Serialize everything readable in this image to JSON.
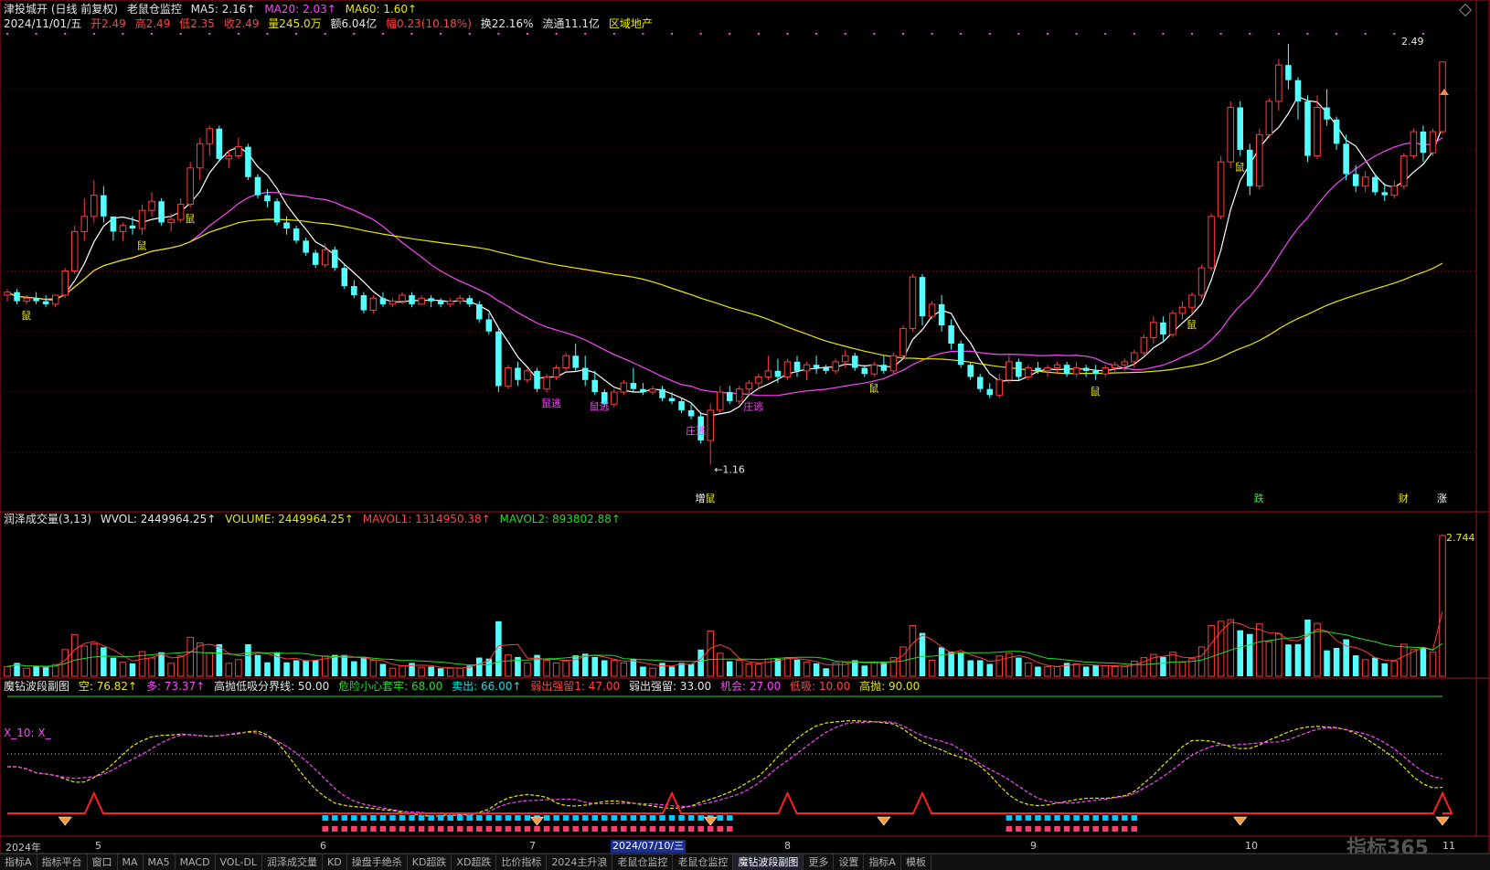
{
  "header": {
    "stock_title": "津投城开 (日线 前复权)",
    "indicator_name": "老鼠仓监控",
    "ma5": "MA5: 2.16↑",
    "ma20": "MA20: 2.03↑",
    "ma60": "MA60: 1.60↑",
    "date": "2024/11/01/五",
    "open": "开2.49",
    "high": "高2.49",
    "low": "低2.35",
    "close": "收2.49",
    "volume": "量245.0万",
    "amount": "额6.04亿",
    "change": "幅0.23(10.18%)",
    "turnover": "换22.16%",
    "float": "流通11.1亿",
    "sector": "区域地产"
  },
  "volume_panel": {
    "title": "润泽成交量(3,13)",
    "wvol": "WVOL: 2449964.25↑",
    "volume": "VOLUME: 2449964.25↑",
    "mavol1": "MAVOL1: 1314950.38↑",
    "mavol2": "MAVOL2: 893802.88↑",
    "max_label": "2.744"
  },
  "indicator_panel": {
    "title": "魔钻波段副图",
    "kong": "空: 76.82↑",
    "duo": "多: 73.37↑",
    "boundary": "高抛低吸分界线: 50.00",
    "danger": "危险小心套牢: 68.00",
    "sell": "卖出: 66.00↑",
    "weak1": "弱出强留1: 47.00",
    "weak2": "弱出强留: 33.00",
    "chance": "机会: 27.00",
    "low_buy": "低吸: 10.00",
    "high_sell": "高抛: 90.00",
    "x10": "X_10: X_"
  },
  "x_axis": {
    "labels": [
      "2024年",
      "5",
      "6",
      "7",
      "8",
      "9",
      "10",
      "11"
    ],
    "current_date": "2024/07/10/三"
  },
  "price_labels": {
    "high_marker": "2.49",
    "low_marker": "←1.16"
  },
  "signals": [
    "鼠",
    "鼠",
    "鼠",
    "鼠逃",
    "鼠逃",
    "庄逃",
    "庄逃",
    "鼠",
    "鼠",
    "鼠",
    "鼠",
    "增",
    "鼠",
    "跌",
    "财",
    "涨"
  ],
  "tabs": [
    "指标A",
    "指标平台",
    "窗口",
    "MA",
    "MA5",
    "MACD",
    "VOL-DL",
    "润泽成交量",
    "KD",
    "操盘手绝杀",
    "KD超跌",
    "XD超跌",
    "比价指标",
    "2024主升浪",
    "老鼠仓监控",
    "老鼠仓监控",
    "魔钻波段副图",
    "更多",
    "设置",
    "指标A",
    "模板"
  ],
  "logo": "指标365",
  "chart_data": {
    "type": "candlestick",
    "title": "津投城开 (日线 前复权)",
    "ylim": [
      1.05,
      2.58
    ],
    "last_close": 2.49,
    "high": 2.49,
    "low": 1.16,
    "ohlc": [
      [
        1.72,
        1.74,
        1.7,
        1.73
      ],
      [
        1.73,
        1.74,
        1.69,
        1.7
      ],
      [
        1.7,
        1.72,
        1.69,
        1.71
      ],
      [
        1.71,
        1.73,
        1.69,
        1.7
      ],
      [
        1.7,
        1.72,
        1.68,
        1.69
      ],
      [
        1.69,
        1.72,
        1.68,
        1.72
      ],
      [
        1.72,
        1.81,
        1.71,
        1.8
      ],
      [
        1.8,
        1.95,
        1.79,
        1.93
      ],
      [
        1.93,
        2.04,
        1.9,
        1.98
      ],
      [
        1.98,
        2.1,
        1.96,
        2.05
      ],
      [
        2.05,
        2.08,
        1.96,
        1.98
      ],
      [
        1.98,
        1.97,
        1.9,
        1.93
      ],
      [
        1.93,
        1.96,
        1.9,
        1.95
      ],
      [
        1.95,
        1.98,
        1.92,
        1.94
      ],
      [
        1.94,
        2.02,
        1.92,
        2.0
      ],
      [
        2.0,
        2.06,
        1.98,
        2.03
      ],
      [
        2.03,
        2.04,
        1.95,
        1.96
      ],
      [
        1.96,
        1.99,
        1.93,
        1.97
      ],
      [
        1.97,
        2.04,
        1.96,
        2.02
      ],
      [
        2.02,
        2.16,
        2.01,
        2.14
      ],
      [
        2.14,
        2.24,
        2.1,
        2.22
      ],
      [
        2.22,
        2.28,
        2.18,
        2.27
      ],
      [
        2.27,
        2.28,
        2.16,
        2.17
      ],
      [
        2.17,
        2.2,
        2.14,
        2.18
      ],
      [
        2.18,
        2.24,
        2.17,
        2.21
      ],
      [
        2.21,
        2.22,
        2.1,
        2.11
      ],
      [
        2.11,
        2.12,
        2.04,
        2.05
      ],
      [
        2.05,
        2.07,
        2.01,
        2.03
      ],
      [
        2.03,
        2.04,
        1.95,
        1.96
      ],
      [
        1.96,
        1.98,
        1.92,
        1.94
      ],
      [
        1.94,
        1.95,
        1.89,
        1.9
      ],
      [
        1.9,
        1.91,
        1.85,
        1.86
      ],
      [
        1.86,
        1.87,
        1.81,
        1.82
      ],
      [
        1.82,
        1.89,
        1.81,
        1.87
      ],
      [
        1.87,
        1.88,
        1.8,
        1.81
      ],
      [
        1.81,
        1.82,
        1.74,
        1.75
      ],
      [
        1.75,
        1.77,
        1.71,
        1.72
      ],
      [
        1.72,
        1.73,
        1.66,
        1.67
      ],
      [
        1.67,
        1.72,
        1.66,
        1.71
      ],
      [
        1.71,
        1.73,
        1.68,
        1.69
      ],
      [
        1.69,
        1.71,
        1.68,
        1.7
      ],
      [
        1.7,
        1.73,
        1.69,
        1.72
      ],
      [
        1.72,
        1.73,
        1.68,
        1.69
      ],
      [
        1.69,
        1.72,
        1.69,
        1.71
      ],
      [
        1.71,
        1.72,
        1.68,
        1.7
      ],
      [
        1.7,
        1.71,
        1.68,
        1.69
      ],
      [
        1.69,
        1.71,
        1.68,
        1.7
      ],
      [
        1.7,
        1.72,
        1.69,
        1.71
      ],
      [
        1.71,
        1.72,
        1.68,
        1.69
      ],
      [
        1.69,
        1.7,
        1.63,
        1.64
      ],
      [
        1.64,
        1.66,
        1.59,
        1.6
      ],
      [
        1.6,
        1.61,
        1.4,
        1.42
      ],
      [
        1.42,
        1.49,
        1.41,
        1.48
      ],
      [
        1.48,
        1.5,
        1.42,
        1.44
      ],
      [
        1.44,
        1.48,
        1.43,
        1.47
      ],
      [
        1.47,
        1.48,
        1.4,
        1.41
      ],
      [
        1.41,
        1.46,
        1.4,
        1.45
      ],
      [
        1.45,
        1.49,
        1.44,
        1.48
      ],
      [
        1.48,
        1.53,
        1.47,
        1.52
      ],
      [
        1.52,
        1.56,
        1.47,
        1.48
      ],
      [
        1.48,
        1.52,
        1.42,
        1.44
      ],
      [
        1.44,
        1.47,
        1.39,
        1.4
      ],
      [
        1.4,
        1.41,
        1.35,
        1.36
      ],
      [
        1.36,
        1.41,
        1.35,
        1.4
      ],
      [
        1.4,
        1.44,
        1.39,
        1.43
      ],
      [
        1.43,
        1.48,
        1.4,
        1.41
      ],
      [
        1.41,
        1.43,
        1.39,
        1.4
      ],
      [
        1.4,
        1.42,
        1.39,
        1.41
      ],
      [
        1.41,
        1.42,
        1.37,
        1.38
      ],
      [
        1.38,
        1.4,
        1.36,
        1.37
      ],
      [
        1.37,
        1.38,
        1.33,
        1.34
      ],
      [
        1.34,
        1.36,
        1.31,
        1.32
      ],
      [
        1.32,
        1.33,
        1.23,
        1.24
      ],
      [
        1.24,
        1.36,
        1.16,
        1.34
      ],
      [
        1.34,
        1.42,
        1.33,
        1.4
      ],
      [
        1.4,
        1.42,
        1.36,
        1.37
      ],
      [
        1.37,
        1.42,
        1.36,
        1.41
      ],
      [
        1.41,
        1.44,
        1.39,
        1.43
      ],
      [
        1.43,
        1.46,
        1.41,
        1.45
      ],
      [
        1.45,
        1.52,
        1.44,
        1.47
      ],
      [
        1.47,
        1.51,
        1.43,
        1.45
      ],
      [
        1.45,
        1.51,
        1.44,
        1.5
      ],
      [
        1.5,
        1.52,
        1.45,
        1.47
      ],
      [
        1.47,
        1.5,
        1.44,
        1.49
      ],
      [
        1.49,
        1.52,
        1.46,
        1.48
      ],
      [
        1.48,
        1.49,
        1.46,
        1.47
      ],
      [
        1.47,
        1.51,
        1.46,
        1.5
      ],
      [
        1.5,
        1.54,
        1.48,
        1.52
      ],
      [
        1.52,
        1.53,
        1.47,
        1.48
      ],
      [
        1.48,
        1.49,
        1.45,
        1.46
      ],
      [
        1.46,
        1.5,
        1.45,
        1.49
      ],
      [
        1.49,
        1.52,
        1.46,
        1.47
      ],
      [
        1.47,
        1.53,
        1.46,
        1.52
      ],
      [
        1.52,
        1.62,
        1.51,
        1.61
      ],
      [
        1.61,
        1.79,
        1.6,
        1.78
      ],
      [
        1.78,
        1.79,
        1.62,
        1.65
      ],
      [
        1.65,
        1.7,
        1.64,
        1.69
      ],
      [
        1.69,
        1.72,
        1.6,
        1.62
      ],
      [
        1.62,
        1.64,
        1.54,
        1.56
      ],
      [
        1.56,
        1.57,
        1.48,
        1.49
      ],
      [
        1.49,
        1.5,
        1.44,
        1.45
      ],
      [
        1.45,
        1.46,
        1.4,
        1.41
      ],
      [
        1.41,
        1.43,
        1.38,
        1.39
      ],
      [
        1.39,
        1.46,
        1.38,
        1.44
      ],
      [
        1.44,
        1.52,
        1.43,
        1.5
      ],
      [
        1.5,
        1.51,
        1.44,
        1.45
      ],
      [
        1.45,
        1.49,
        1.44,
        1.48
      ],
      [
        1.48,
        1.5,
        1.46,
        1.47
      ],
      [
        1.47,
        1.49,
        1.45,
        1.48
      ],
      [
        1.48,
        1.5,
        1.46,
        1.49
      ],
      [
        1.49,
        1.5,
        1.45,
        1.46
      ],
      [
        1.46,
        1.5,
        1.45,
        1.48
      ],
      [
        1.48,
        1.49,
        1.45,
        1.47
      ],
      [
        1.47,
        1.49,
        1.44,
        1.46
      ],
      [
        1.46,
        1.49,
        1.45,
        1.48
      ],
      [
        1.48,
        1.5,
        1.46,
        1.49
      ],
      [
        1.49,
        1.51,
        1.47,
        1.5
      ],
      [
        1.5,
        1.54,
        1.48,
        1.53
      ],
      [
        1.53,
        1.59,
        1.52,
        1.58
      ],
      [
        1.58,
        1.65,
        1.56,
        1.63
      ],
      [
        1.63,
        1.65,
        1.57,
        1.59
      ],
      [
        1.59,
        1.67,
        1.58,
        1.66
      ],
      [
        1.66,
        1.7,
        1.64,
        1.68
      ],
      [
        1.68,
        1.73,
        1.66,
        1.72
      ],
      [
        1.72,
        1.82,
        1.71,
        1.81
      ],
      [
        1.81,
        1.99,
        1.8,
        1.98
      ],
      [
        1.98,
        2.18,
        1.97,
        2.16
      ],
      [
        2.16,
        2.36,
        2.14,
        2.34
      ],
      [
        2.34,
        2.36,
        2.18,
        2.2
      ],
      [
        2.2,
        2.22,
        2.05,
        2.08
      ],
      [
        2.08,
        2.27,
        2.07,
        2.25
      ],
      [
        2.25,
        2.37,
        2.24,
        2.36
      ],
      [
        2.36,
        2.5,
        2.33,
        2.48
      ],
      [
        2.48,
        2.55,
        2.4,
        2.43
      ],
      [
        2.43,
        2.44,
        2.3,
        2.36
      ],
      [
        2.36,
        2.38,
        2.16,
        2.18
      ],
      [
        2.18,
        2.38,
        2.17,
        2.34
      ],
      [
        2.34,
        2.4,
        2.28,
        2.3
      ],
      [
        2.3,
        2.31,
        2.2,
        2.22
      ],
      [
        2.22,
        2.25,
        2.1,
        2.12
      ],
      [
        2.12,
        2.15,
        2.06,
        2.08
      ],
      [
        2.08,
        2.13,
        2.06,
        2.11
      ],
      [
        2.11,
        2.12,
        2.05,
        2.06
      ],
      [
        2.06,
        2.09,
        2.03,
        2.05
      ],
      [
        2.05,
        2.1,
        2.04,
        2.08
      ],
      [
        2.08,
        2.19,
        2.07,
        2.18
      ],
      [
        2.18,
        2.27,
        2.17,
        2.26
      ],
      [
        2.26,
        2.28,
        2.16,
        2.19
      ],
      [
        2.19,
        2.27,
        2.18,
        2.26
      ],
      [
        2.26,
        2.49,
        2.25,
        2.49
      ]
    ],
    "ma_series": [
      {
        "name": "MA5",
        "color": "#ffffff"
      },
      {
        "name": "MA20",
        "color": "#ff44ff"
      },
      {
        "name": "MA60",
        "color": "#e8e800"
      }
    ],
    "volume_series": [
      {
        "name": "VOLUME"
      },
      {
        "name": "MAVOL1"
      },
      {
        "name": "MAVOL2"
      }
    ]
  }
}
